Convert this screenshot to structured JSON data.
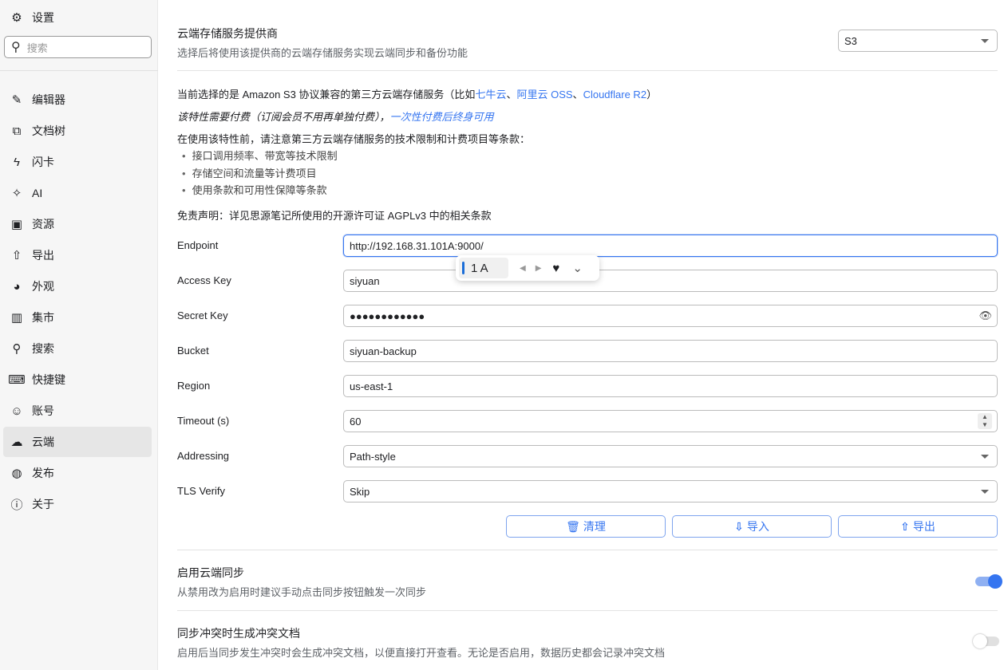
{
  "sidebar": {
    "title": "设置",
    "search_placeholder": "搜索",
    "items": [
      {
        "label": "编辑器",
        "icon": "pencil-icon",
        "glyph": "✎"
      },
      {
        "label": "文档树",
        "icon": "tree-icon",
        "glyph": "⧉"
      },
      {
        "label": "闪卡",
        "icon": "lightning-icon",
        "glyph": "ϟ"
      },
      {
        "label": "AI",
        "icon": "sparkle-icon",
        "glyph": "✧"
      },
      {
        "label": "资源",
        "icon": "image-icon",
        "glyph": "▣"
      },
      {
        "label": "导出",
        "icon": "upload-icon",
        "glyph": "⇧"
      },
      {
        "label": "外观",
        "icon": "palette-icon",
        "glyph": "◕"
      },
      {
        "label": "集市",
        "icon": "store-icon",
        "glyph": "▥"
      },
      {
        "label": "搜索",
        "icon": "search-icon",
        "glyph": "⚲"
      },
      {
        "label": "快捷键",
        "icon": "keyboard-icon",
        "glyph": "⌨"
      },
      {
        "label": "账号",
        "icon": "user-icon",
        "glyph": "☺"
      },
      {
        "label": "云端",
        "icon": "cloud-icon",
        "glyph": "☁"
      },
      {
        "label": "发布",
        "icon": "globe-icon",
        "glyph": "◍"
      },
      {
        "label": "关于",
        "icon": "info-icon",
        "glyph": "ⓘ"
      }
    ],
    "active": 11
  },
  "provider": {
    "title": "云端存储服务提供商",
    "desc": "选择后将使用该提供商的云端存储服务实现云端同步和备份功能",
    "value": "S3"
  },
  "info": {
    "line1_prefix": "当前选择的是 Amazon S3 协议兼容的第三方云端存储服务（比如",
    "link1": "七牛云",
    "sep1": "、",
    "link2": "阿里云 OSS",
    "sep2": "、",
    "link3": "Cloudflare R2",
    "line1_suffix": "）",
    "line2": "该特性需要付费（订阅会员不用再单独付费），",
    "line2_link": "一次性付费后终身可用",
    "line3": "在使用该特性前，请注意第三方云端存储服务的技术限制和计费项目等条款：",
    "bullets": [
      "接口调用频率、带宽等技术限制",
      "存储空间和流量等计费项目",
      "使用条款和可用性保障等条款"
    ],
    "disclaimer": "免责声明：详见思源笔记所使用的开源许可证 AGPLv3 中的相关条款"
  },
  "form": [
    {
      "label": "Endpoint",
      "value": "http://192.168.31.101A:9000/",
      "type": "text"
    },
    {
      "label": "Access Key",
      "value": "siyuan",
      "type": "text"
    },
    {
      "label": "Secret Key",
      "value": "●●●●●●●●●●●●",
      "type": "password"
    },
    {
      "label": "Bucket",
      "value": "siyuan-backup",
      "type": "text"
    },
    {
      "label": "Region",
      "value": "us-east-1",
      "type": "text"
    },
    {
      "label": "Timeout (s)",
      "value": "60",
      "type": "number"
    },
    {
      "label": "Addressing",
      "value": "Path-style",
      "type": "select"
    },
    {
      "label": "TLS Verify",
      "value": "Skip",
      "type": "select"
    }
  ],
  "buttons": {
    "purge": "清理",
    "import": "导入",
    "export": "导出"
  },
  "ime": {
    "candidate": "1 A"
  },
  "sync": {
    "title": "启用云端同步",
    "desc": "从禁用改为启用时建议手动点击同步按钮触发一次同步",
    "enabled": true
  },
  "conflict": {
    "title": "同步冲突时生成冲突文档",
    "desc": "启用后当同步发生冲突时会生成冲突文档，以便直接打开查看。无论是否启用，数据历史都会记录冲突文档",
    "enabled": false
  },
  "colors": {
    "accent": "#3575f0"
  }
}
